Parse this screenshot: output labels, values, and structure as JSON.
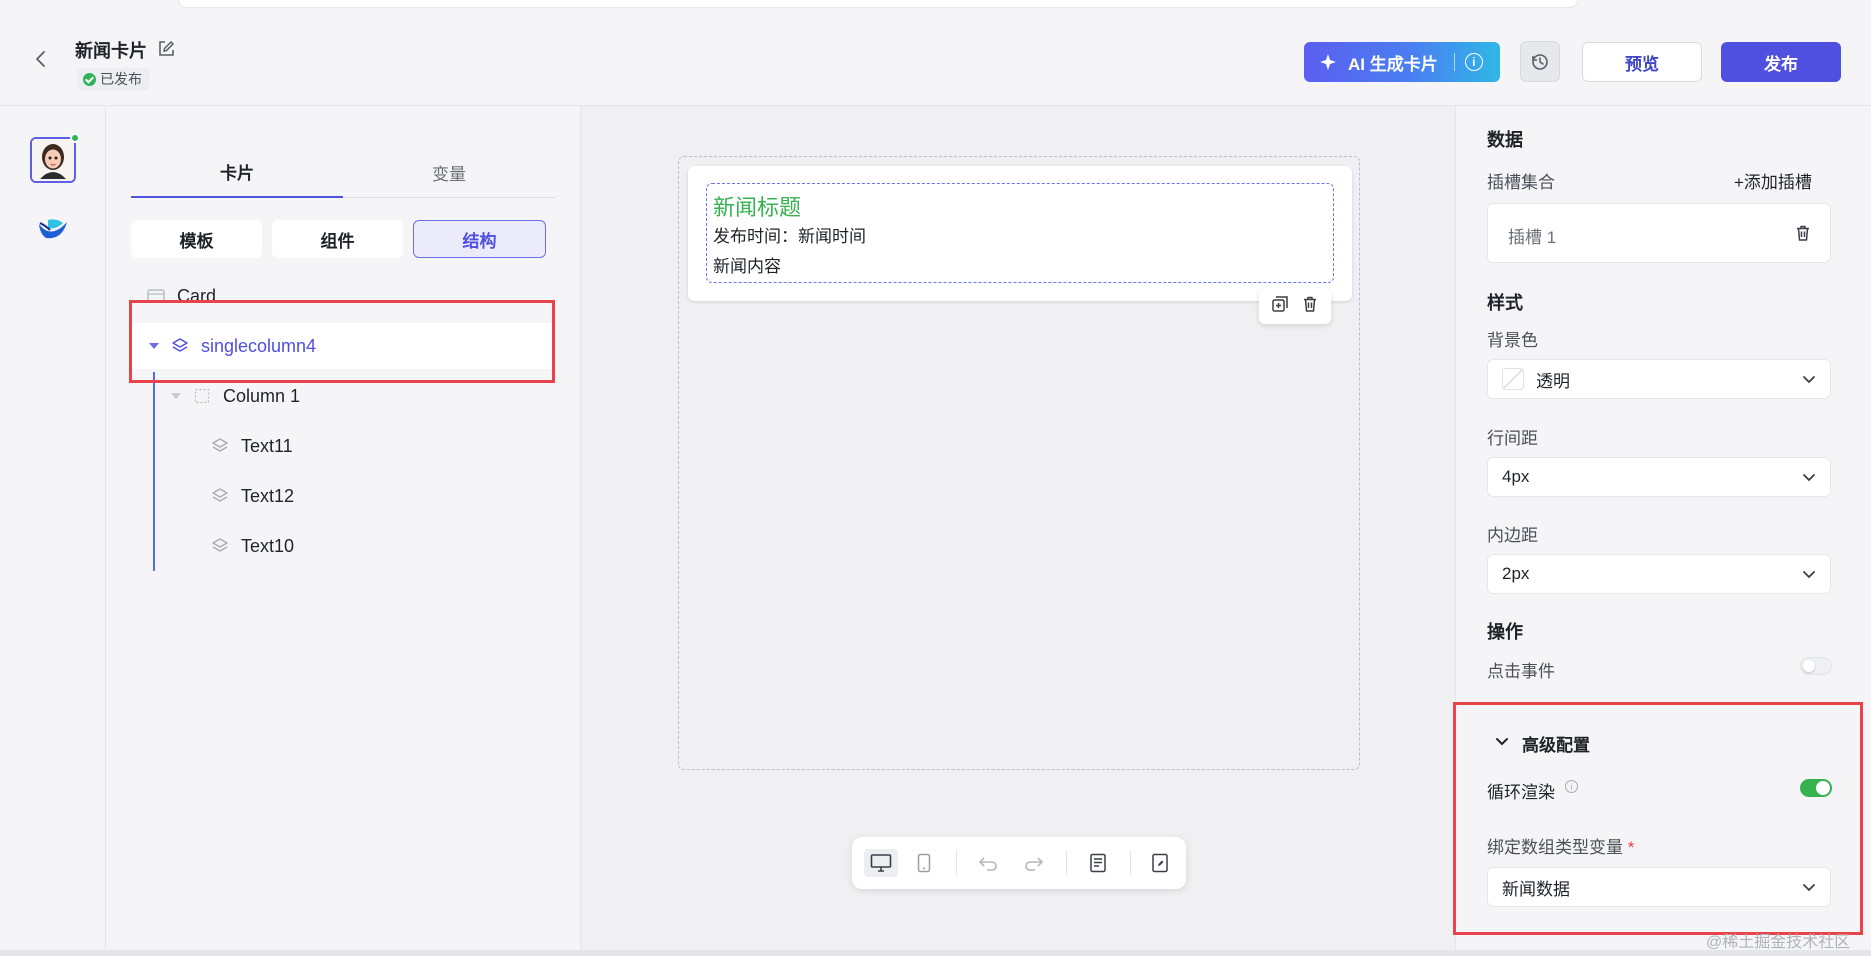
{
  "header": {
    "title": "新闻卡片",
    "status": "已发布",
    "ai_button": "AI 生成卡片",
    "preview": "预览",
    "publish": "发布"
  },
  "panel": {
    "tabs": [
      "卡片",
      "变量"
    ],
    "segments": [
      "模板",
      "组件",
      "结构"
    ],
    "tree": {
      "card": "Card",
      "single": "singlecolumn4",
      "column": "Column 1",
      "text11": "Text11",
      "text12": "Text12",
      "text10": "Text10"
    }
  },
  "canvas": {
    "news_title": "新闻标题",
    "news_time": "发布时间：新闻时间",
    "news_content": "新闻内容"
  },
  "props": {
    "data_title": "数据",
    "slot_collection": "插槽集合",
    "add_slot": "+添加插槽",
    "slot1": "插槽 1",
    "style_title": "样式",
    "bg_label": "背景色",
    "bg_value": "透明",
    "line_gap_label": "行间距",
    "line_gap_value": "4px",
    "padding_label": "内边距",
    "padding_value": "2px",
    "action_title": "操作",
    "click_event": "点击事件",
    "advanced": "高级配置",
    "loop_render": "循环渲染",
    "bind_label": "绑定数组类型变量",
    "required_mark": "*",
    "bind_value": "新闻数据"
  },
  "watermark": "@稀土掘金技术社区",
  "colors": {
    "accent": "#4f4fe0",
    "title_green": "#36b24f",
    "highlight_red": "#e8424a",
    "toggle_on": "#34b350"
  }
}
